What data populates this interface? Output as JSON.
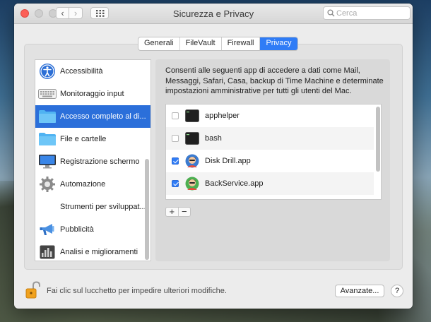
{
  "window": {
    "title": "Sicurezza e Privacy"
  },
  "toolbar": {
    "search_placeholder": "Cerca"
  },
  "tabs": [
    {
      "label": "Generali",
      "active": false
    },
    {
      "label": "FileVault",
      "active": false
    },
    {
      "label": "Firewall",
      "active": false
    },
    {
      "label": "Privacy",
      "active": true
    }
  ],
  "sidebar": {
    "items": [
      {
        "label": "Accessibilità",
        "icon": "accessibility-icon"
      },
      {
        "label": "Monitoraggio input",
        "icon": "keyboard-icon"
      },
      {
        "label": "Accesso completo al di...",
        "icon": "folder-icon",
        "selected": true
      },
      {
        "label": "File e cartelle",
        "icon": "folder-icon"
      },
      {
        "label": "Registrazione schermo",
        "icon": "display-icon"
      },
      {
        "label": "Automazione",
        "icon": "gear-icon"
      },
      {
        "label": "Strumenti per sviluppat...",
        "icon": ""
      },
      {
        "label": "Pubblicità",
        "icon": "megaphone-icon"
      },
      {
        "label": "Analisi e miglioramenti",
        "icon": "chart-icon"
      }
    ]
  },
  "main": {
    "description": "Consenti alle seguenti app di accedere a dati come Mail, Messaggi, Safari, Casa, backup di Time Machine e determinate impostazioni amministrative per tutti gli utenti del Mac.",
    "apps": [
      {
        "name": "apphelper",
        "checked": false,
        "icon": "terminal-icon"
      },
      {
        "name": "bash",
        "checked": false,
        "icon": "terminal-icon"
      },
      {
        "name": "Disk Drill.app",
        "checked": true,
        "icon": "avatar-icon"
      },
      {
        "name": "BackService.app",
        "checked": true,
        "icon": "avatar-icon"
      }
    ],
    "add_label": "+",
    "remove_label": "−"
  },
  "footer": {
    "lock_text": "Fai clic sul lucchetto per impedire ulteriori modifiche.",
    "advanced_label": "Avanzate...",
    "help_label": "?"
  },
  "colors": {
    "accent": "#2f7cf6",
    "selection": "#2b6fda"
  }
}
